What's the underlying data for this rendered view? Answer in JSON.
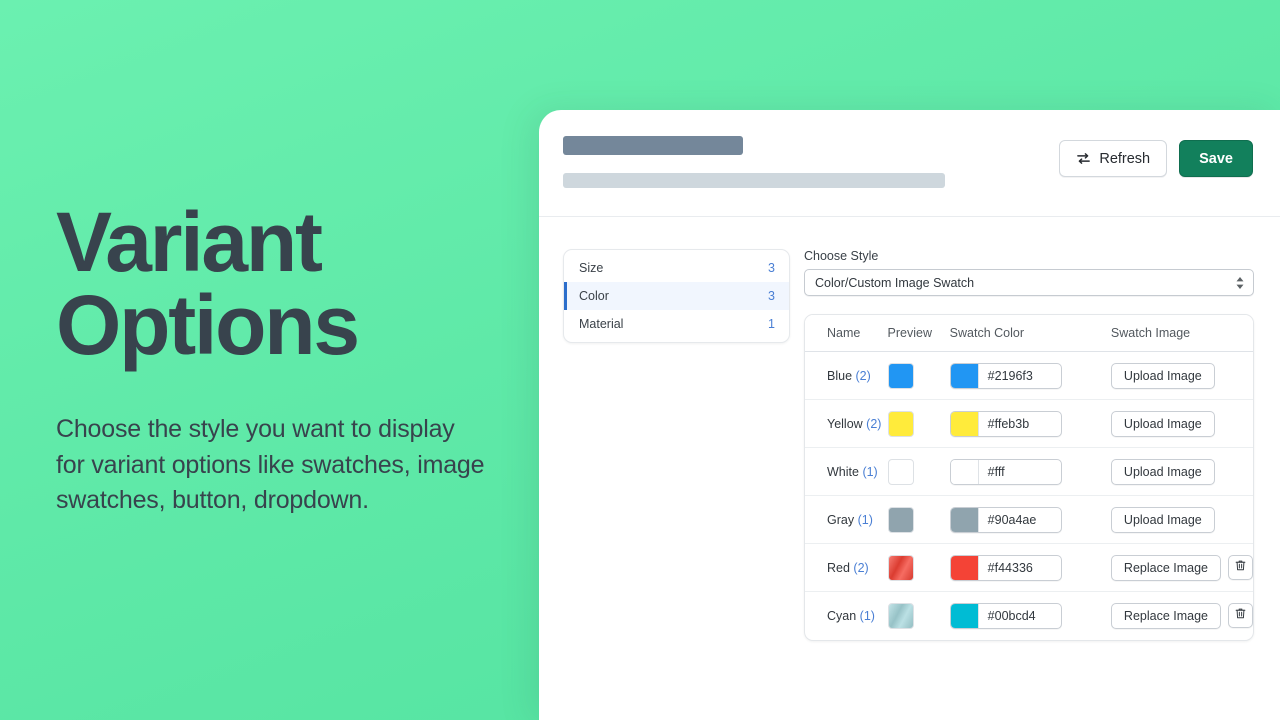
{
  "promo": {
    "title_line1": "Variant",
    "title_line2": "Options",
    "body": "Choose the style you want to display for variant options like swatches, image swatches, button, dropdown.",
    "text_color": "#38434d",
    "background": "#5fe9a8"
  },
  "header": {
    "refresh_label": "Refresh",
    "save_label": "Save",
    "save_color": "#12805c",
    "skeleton_title_color": "#74879a",
    "skeleton_sub_color": "#ced7dd"
  },
  "option_list": [
    {
      "label": "Size",
      "count": "3",
      "active": false
    },
    {
      "label": "Color",
      "count": "3",
      "active": true
    },
    {
      "label": "Material",
      "count": "1",
      "active": false
    }
  ],
  "style_field": {
    "label": "Choose Style",
    "value": "Color/Custom Image Swatch"
  },
  "table": {
    "columns": [
      "Name",
      "Preview",
      "Swatch Color",
      "Swatch Image"
    ],
    "rows": [
      {
        "name": "Blue",
        "count": "(2)",
        "preview": "#2196f3",
        "preview_type": "color",
        "hex": "#2196f3",
        "image_action": "Upload Image",
        "has_delete": false
      },
      {
        "name": "Yellow",
        "count": "(2)",
        "preview": "#ffeb3b",
        "preview_type": "color",
        "hex": "#ffeb3b",
        "image_action": "Upload Image",
        "has_delete": false
      },
      {
        "name": "White",
        "count": "(1)",
        "preview": "#ffffff",
        "preview_type": "color",
        "hex": "#fff",
        "image_action": "Upload Image",
        "has_delete": false
      },
      {
        "name": "Gray",
        "count": "(1)",
        "preview": "#90a4ae",
        "preview_type": "color",
        "hex": "#90a4ae",
        "image_action": "Upload Image",
        "has_delete": false
      },
      {
        "name": "Red",
        "count": "(2)",
        "preview": "#f44336",
        "preview_type": "image",
        "hex": "#f44336",
        "image_action": "Replace Image",
        "has_delete": true
      },
      {
        "name": "Cyan",
        "count": "(1)",
        "preview": "#a8d8dd",
        "preview_type": "image",
        "hex": "#00bcd4",
        "image_action": "Replace Image",
        "has_delete": true
      }
    ]
  }
}
